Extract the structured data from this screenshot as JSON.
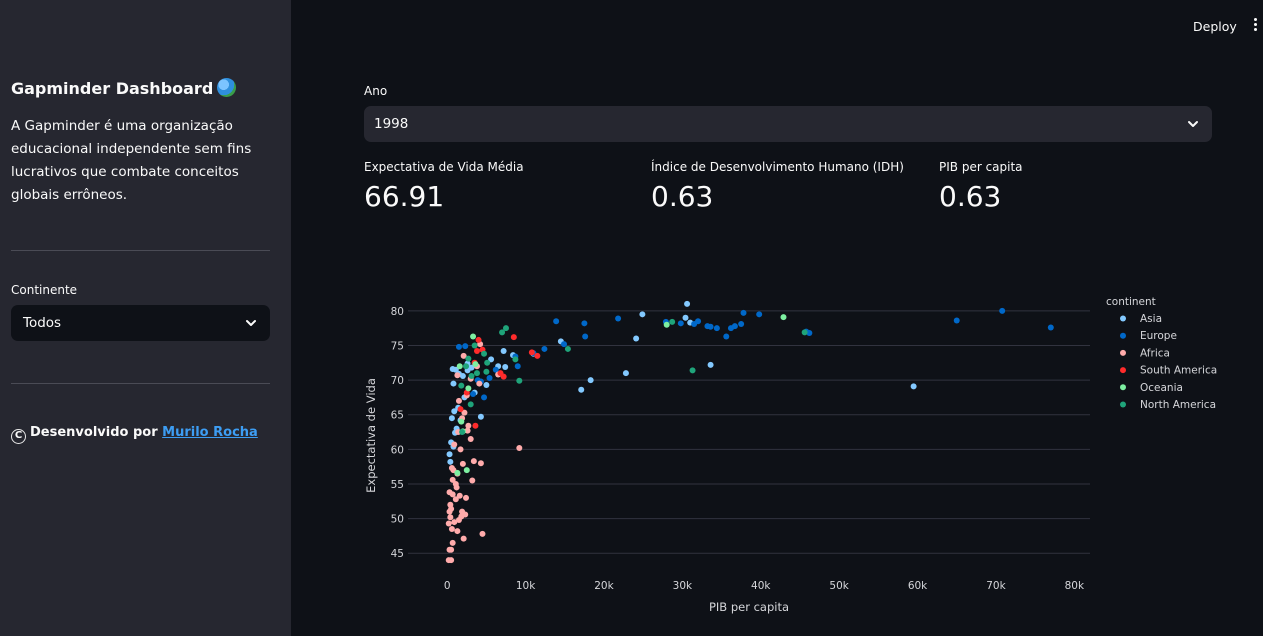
{
  "sidebar": {
    "title": "Gapminder Dashboard",
    "description": "A Gapminder é uma organização educacional independente sem fins lucrativos que combate conceitos globais errôneos.",
    "continent_label": "Continente",
    "continent_selected": "Todos",
    "footer_prefix": "Desenvolvido por",
    "footer_link": "Murilo Rocha",
    "copyright_symbol": "C"
  },
  "header": {
    "deploy_label": "Deploy"
  },
  "main": {
    "year_label": "Ano",
    "year_selected": "1998",
    "metrics": [
      {
        "label": "Expectativa de Vida Média",
        "value": "66.91"
      },
      {
        "label": "Índice de Desenvolvimento Humano (IDH)",
        "value": "0.63"
      },
      {
        "label": "PIB per capita",
        "value": "0.63"
      }
    ]
  },
  "chart_data": {
    "type": "scatter",
    "xlabel": "PIB per capita",
    "ylabel": "Expectativa de Vida",
    "xlim": [
      -5000,
      82000
    ],
    "ylim": [
      42,
      82
    ],
    "x_ticks": [
      0,
      10000,
      20000,
      30000,
      40000,
      50000,
      60000,
      70000,
      80000
    ],
    "x_tick_labels": [
      "0",
      "10k",
      "20k",
      "30k",
      "40k",
      "50k",
      "60k",
      "70k",
      "80k"
    ],
    "y_ticks": [
      45,
      50,
      55,
      60,
      65,
      70,
      75,
      80
    ],
    "y_tick_labels": [
      "45",
      "50",
      "55",
      "60",
      "65",
      "70",
      "75",
      "80"
    ],
    "grid": "horizontal",
    "legend_title": "continent",
    "legend_position": "right",
    "series": [
      {
        "name": "Asia",
        "color": "#83c9ff",
        "points": [
          [
            30600,
            81
          ],
          [
            24900,
            79.5
          ],
          [
            30400,
            79
          ],
          [
            31000,
            78.3
          ],
          [
            24100,
            76
          ],
          [
            14500,
            75.6
          ],
          [
            18300,
            70
          ],
          [
            17100,
            68.6
          ],
          [
            22800,
            71
          ],
          [
            33600,
            72.2
          ],
          [
            59500,
            69.1
          ],
          [
            700,
            71.6
          ],
          [
            1100,
            71.5
          ],
          [
            800,
            69.5
          ],
          [
            1500,
            70.9
          ],
          [
            2000,
            70.6
          ],
          [
            2600,
            71.4
          ],
          [
            3100,
            71.8
          ],
          [
            900,
            65.5
          ],
          [
            1400,
            66
          ],
          [
            600,
            64.5
          ],
          [
            1200,
            63
          ],
          [
            2200,
            67.5
          ],
          [
            3500,
            68.2
          ],
          [
            5000,
            69.3
          ],
          [
            300,
            59.3
          ],
          [
            500,
            61
          ],
          [
            800,
            60.4
          ],
          [
            1000,
            62.4
          ],
          [
            1700,
            64.2
          ],
          [
            400,
            58.2
          ],
          [
            4300,
            64.7
          ],
          [
            6500,
            72
          ],
          [
            7400,
            71.9
          ],
          [
            8400,
            73.6
          ],
          [
            11000,
            73.8
          ],
          [
            5600,
            73
          ],
          [
            7200,
            74.2
          ],
          [
            2600,
            72.4
          ]
        ]
      },
      {
        "name": "Europe",
        "color": "#0068c9",
        "points": [
          [
            13900,
            78.5
          ],
          [
            17500,
            78.2
          ],
          [
            21800,
            78.9
          ],
          [
            27900,
            78.4
          ],
          [
            29800,
            78.2
          ],
          [
            31500,
            78.1
          ],
          [
            32000,
            78.5
          ],
          [
            33200,
            77.8
          ],
          [
            33600,
            77.7
          ],
          [
            35600,
            76.3
          ],
          [
            36200,
            77.5
          ],
          [
            36700,
            77.8
          ],
          [
            37500,
            78.1
          ],
          [
            37800,
            79.7
          ],
          [
            39800,
            79.5
          ],
          [
            45800,
            77.0
          ],
          [
            46200,
            76.8
          ],
          [
            65000,
            78.6
          ],
          [
            70800,
            80
          ],
          [
            77000,
            77.6
          ],
          [
            34400,
            77.5
          ],
          [
            12400,
            74.5
          ],
          [
            14900,
            75.2
          ],
          [
            11000,
            73.9
          ],
          [
            9000,
            72
          ],
          [
            6200,
            71.5
          ],
          [
            5400,
            70.3
          ],
          [
            4300,
            69.8
          ],
          [
            8700,
            73.4
          ],
          [
            2300,
            74.9
          ],
          [
            1500,
            74.8
          ],
          [
            17600,
            76.3
          ],
          [
            4700,
            67.5
          ],
          [
            3300,
            68.0
          ],
          [
            3900,
            70.0
          ]
        ]
      },
      {
        "name": "Africa",
        "color": "#ffabab",
        "points": [
          [
            9200,
            60.2
          ],
          [
            4300,
            58
          ],
          [
            4500,
            47.8
          ],
          [
            3200,
            55.5
          ],
          [
            2400,
            53
          ],
          [
            1900,
            51
          ],
          [
            2300,
            50.6
          ],
          [
            1800,
            50.3
          ],
          [
            1500,
            49.8
          ],
          [
            500,
            45.5
          ],
          [
            300,
            45.5
          ],
          [
            200,
            44
          ],
          [
            500,
            44
          ],
          [
            600,
            48.5
          ],
          [
            900,
            49.5
          ],
          [
            400,
            52
          ],
          [
            700,
            53.5
          ],
          [
            1100,
            55
          ],
          [
            1300,
            56.5
          ],
          [
            800,
            57
          ],
          [
            600,
            57.3
          ],
          [
            2000,
            57.9
          ],
          [
            1700,
            60
          ],
          [
            3000,
            61.5
          ],
          [
            2700,
            63.4
          ],
          [
            1400,
            62.5
          ],
          [
            900,
            60.7
          ],
          [
            500,
            51.4
          ],
          [
            300,
            51
          ],
          [
            1100,
            52.8
          ],
          [
            1600,
            53.3
          ],
          [
            1200,
            54.5
          ],
          [
            700,
            55.6
          ],
          [
            300,
            53.8
          ],
          [
            400,
            50.2
          ],
          [
            200,
            49.3
          ],
          [
            700,
            46.5
          ],
          [
            1300,
            48.2
          ],
          [
            2100,
            47.1
          ],
          [
            3400,
            58.3
          ],
          [
            2600,
            62.7
          ],
          [
            1900,
            64.5
          ],
          [
            2200,
            65.3
          ],
          [
            1500,
            67
          ],
          [
            2500,
            67.8
          ],
          [
            3000,
            70.2
          ],
          [
            4100,
            69.5
          ],
          [
            1300,
            70.7
          ],
          [
            2100,
            73.5
          ],
          [
            4200,
            75.2
          ],
          [
            3800,
            72
          ],
          [
            6500,
            70.8
          ]
        ]
      },
      {
        "name": "South America",
        "color": "#ff2b2b",
        "points": [
          [
            8500,
            76.2
          ],
          [
            4000,
            75.8
          ],
          [
            3800,
            74.2
          ],
          [
            4500,
            74.4
          ],
          [
            10800,
            74.0
          ],
          [
            11500,
            73.5
          ],
          [
            6800,
            71
          ],
          [
            7200,
            70.5
          ],
          [
            3500,
            72.5
          ],
          [
            1700,
            65.8
          ],
          [
            3600,
            63.4
          ],
          [
            2500,
            68.2
          ]
        ]
      },
      {
        "name": "Oceania",
        "color": "#7defa1",
        "points": [
          [
            28000,
            78
          ],
          [
            42900,
            79.1
          ],
          [
            3300,
            76.3
          ],
          [
            1800,
            64
          ],
          [
            2500,
            57
          ],
          [
            2700,
            68.8
          ],
          [
            1300,
            56.6
          ],
          [
            2000,
            62.6
          ],
          [
            3600,
            72.3
          ],
          [
            1600,
            72.0
          ]
        ]
      },
      {
        "name": "North America",
        "color": "#1fa47a",
        "points": [
          [
            45600,
            76.9
          ],
          [
            31300,
            71.4
          ],
          [
            28700,
            78.4
          ],
          [
            7500,
            77.5
          ],
          [
            7000,
            76.9
          ],
          [
            9200,
            69.9
          ],
          [
            15400,
            74.5
          ],
          [
            8700,
            73
          ],
          [
            5100,
            72.5
          ],
          [
            3500,
            75
          ],
          [
            5000,
            71.2
          ],
          [
            2400,
            72
          ],
          [
            3800,
            71
          ],
          [
            3100,
            70.6
          ],
          [
            3000,
            66.5
          ],
          [
            1900,
            62.5
          ],
          [
            2700,
            73.1
          ],
          [
            1800,
            69.2
          ],
          [
            4700,
            73.8
          ]
        ]
      }
    ]
  }
}
